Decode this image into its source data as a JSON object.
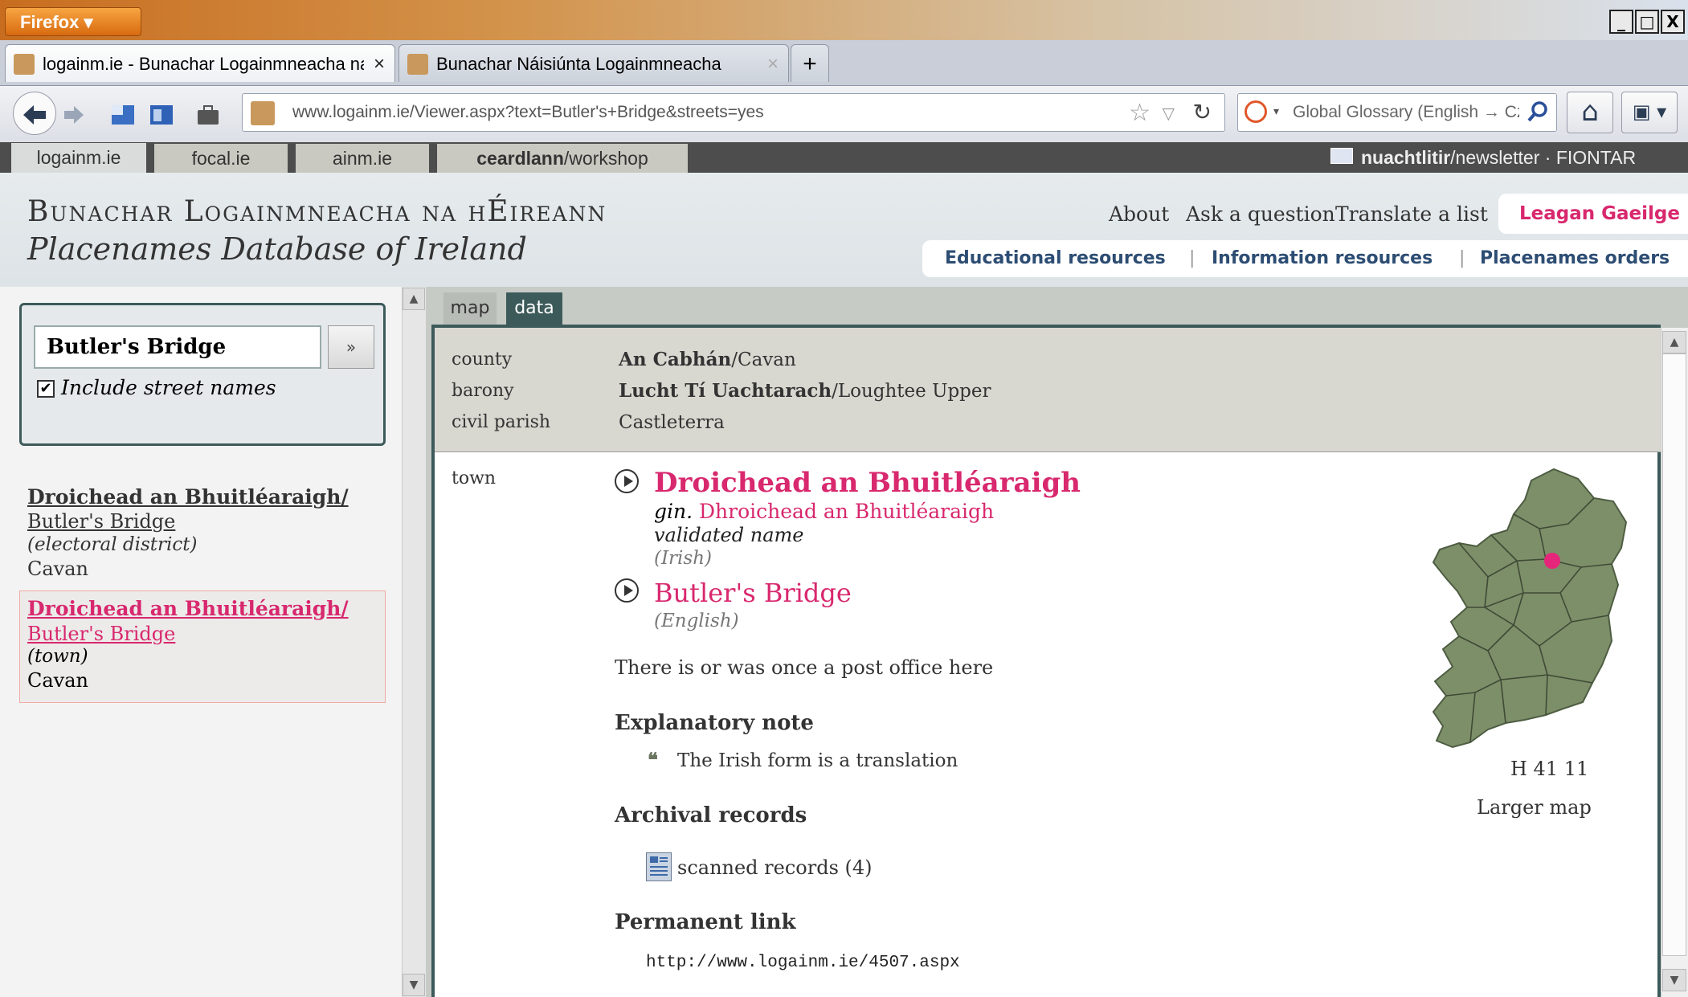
{
  "browser": {
    "app_button": "Firefox",
    "window_controls": [
      "_",
      "□",
      "X"
    ],
    "tabs": [
      {
        "label": "logainm.ie - Bunachar Logainmneacha na ...",
        "close": "×"
      },
      {
        "label": "Bunachar Náisiúnta Logainmneacha",
        "close": "×"
      }
    ],
    "new_tab": "+",
    "url": "www.logainm.ie/Viewer.aspx?text=Butler's+Bridge&streets=yes",
    "search_placeholder": "Global Glossary (English → Cz"
  },
  "site_nav": {
    "tabs": [
      "logainm.ie",
      "focal.ie",
      "ainm.ie",
      "ceardlann",
      "/workshop"
    ],
    "newsletter_bold": "nuachtlitir",
    "newsletter_rest": "/newsletter",
    "sep": "·",
    "fiontar": "FIONTAR"
  },
  "header": {
    "title": "Bunachar Logainmneacha na hÉireann",
    "subtitle": "Placenames Database of Ireland",
    "links": [
      "About",
      "Ask a question",
      "Translate a list"
    ],
    "irish_version": "Leagan Gaeilge",
    "resources": [
      "Educational resources",
      "Information resources",
      "Placenames orders"
    ],
    "res_sep": "|"
  },
  "search": {
    "value": "Butler's Bridge",
    "go_label": "»",
    "checkbox_checked": "✔",
    "checkbox_label": "Include street names"
  },
  "results": [
    {
      "irish": "Droichead an Bhuitléaraigh/",
      "english": "Butler's Bridge",
      "type": "(electoral district)",
      "county": "Cavan"
    },
    {
      "irish": "Droichead an Bhuitléaraigh/",
      "english": "Butler's Bridge",
      "type": "(town)",
      "county": "Cavan"
    }
  ],
  "main": {
    "tabs": [
      "map",
      "data"
    ],
    "info": {
      "county_label": "county",
      "county_irish": "An Cabhán",
      "county_english": "/Cavan",
      "barony_label": "barony",
      "barony_irish": "Lucht Tí Uachtarach",
      "barony_english": "/Loughtee Upper",
      "parish_label": "civil parish",
      "parish_value": "Castleterra"
    },
    "type_label": "town",
    "irish_name": "Droichead an Bhuitléaraigh",
    "gen_prefix": "gin.",
    "gen_name": "Dhroichead an Bhuitléaraigh",
    "validated": "validated name",
    "irish_lang": "(Irish)",
    "english_name": "Butler's Bridge",
    "english_lang": "(English)",
    "post_office": "There is or was once a post office here",
    "note_heading": "Explanatory note",
    "quote_mark": "❝",
    "note_text": "The Irish form is a translation",
    "archival_heading": "Archival records",
    "scanned_records": "scanned records (4)",
    "permanent_heading": "Permanent link",
    "permanent_url": "http://www.logainm.ie/4507.aspx",
    "grid_ref": "H 41 11",
    "larger_map": "Larger map"
  },
  "colors": {
    "accent_pink": "#d8286e",
    "nav_blue": "#2d4d73",
    "panel_border": "#3d5a5a",
    "map_green": "#7d8f69"
  }
}
